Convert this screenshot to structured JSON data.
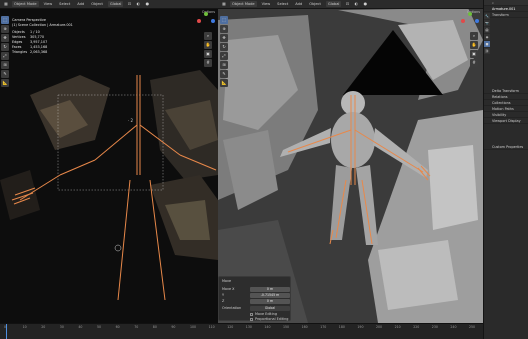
{
  "left_viewport": {
    "header": {
      "mode": "Object Mode",
      "view": "View",
      "select": "Select",
      "add": "Add",
      "object": "Object",
      "orientation": "Global"
    },
    "options": "Options",
    "info": {
      "camera": "Camera Perspective",
      "collection": "(1) Scene Collection | Armature.001"
    },
    "stats": [
      {
        "label": "Objects",
        "value": "1 / 10"
      },
      {
        "label": "Vertices",
        "value": "305,770"
      },
      {
        "label": "Edges",
        "value": "3,957,107"
      },
      {
        "label": "Faces",
        "value": "1,453,168"
      },
      {
        "label": "Triangles",
        "value": "2,063,368"
      }
    ]
  },
  "right_viewport": {
    "header": {
      "mode": "Object Mode",
      "view": "View",
      "select": "Select",
      "add": "Add",
      "object": "Object",
      "orientation": "Global"
    },
    "options": "Options"
  },
  "properties": {
    "title": "Armature.001",
    "rows": [
      "Transform",
      "Delta Transform",
      "Relations",
      "Collections",
      "Motion Paths",
      "Visibility",
      "Viewport Display",
      "Custom Properties"
    ]
  },
  "redo_panel": {
    "title": "Move",
    "move_x": "0 m",
    "move_y": "-0.71545 m",
    "move_z": "0 m",
    "orientation_label": "Orientation",
    "orientation_value": "Global",
    "prop_edit": "Proportional Editing",
    "edit_label": "Move Editing"
  },
  "timeline": {
    "ticks": [
      "0",
      "10",
      "20",
      "30",
      "40",
      "50",
      "60",
      "70",
      "80",
      "90",
      "100",
      "110",
      "120",
      "130",
      "140",
      "150",
      "160",
      "170",
      "180",
      "190",
      "200",
      "210",
      "220",
      "230",
      "240",
      "250"
    ]
  },
  "colors": {
    "armature": "#e8884a",
    "accent": "#4f6fa0",
    "panel": "#2a2a2a"
  }
}
